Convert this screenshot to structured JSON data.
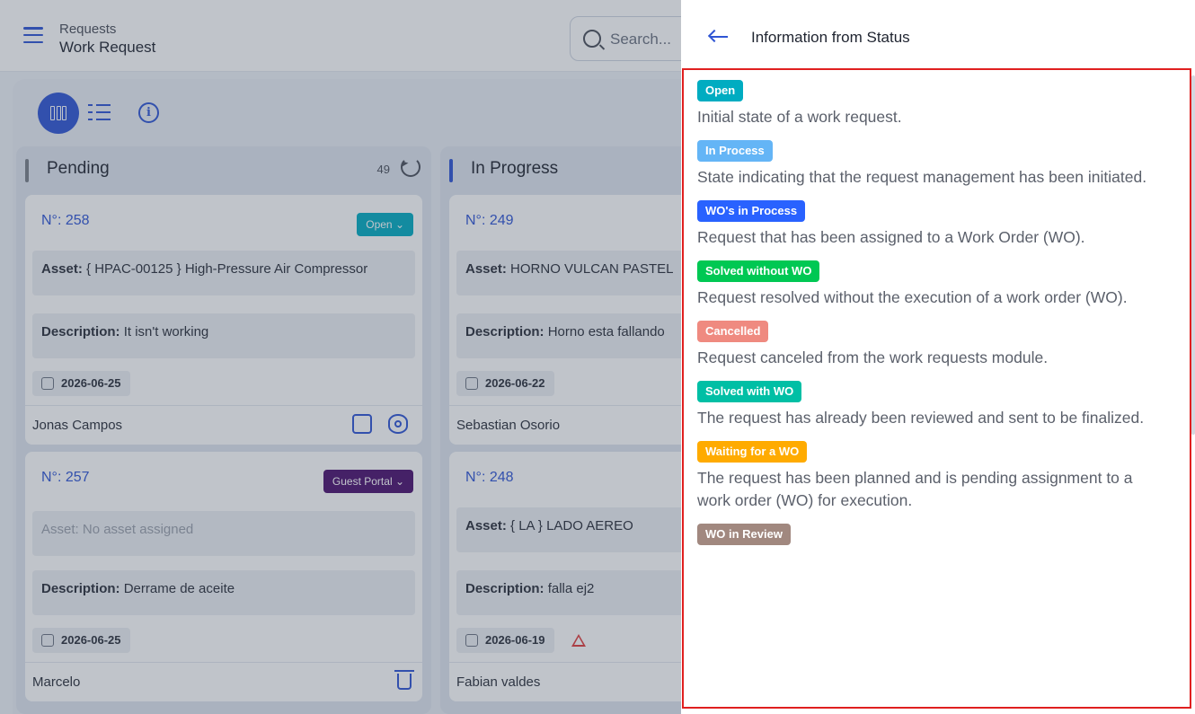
{
  "header": {
    "breadcrumb_parent": "Requests",
    "page_title": "Work Request",
    "search_placeholder": "Search..."
  },
  "board": {
    "columns": [
      {
        "title": "Pending",
        "count": "49",
        "marker_color": "#7a7f88",
        "cards": [
          {
            "number": "N°: 258",
            "status": "Open ⌄",
            "status_color": "#00acc1",
            "asset_label": "Asset:",
            "asset_value": "{ HPAC-00125 } High-Pressure Air Compressor",
            "description_label": "Description:",
            "description_value": "It isn't working",
            "date": "2026-06-25",
            "user": "Jonas Campos"
          },
          {
            "number": "N°: 257",
            "status": "Guest Portal ⌄",
            "status_color": "#4b0f6e",
            "asset_label": "Asset:",
            "asset_value": "No asset assigned",
            "description_label": "Description:",
            "description_value": "Derrame de aceite",
            "date": "2026-06-25",
            "user": "Marcelo"
          }
        ]
      },
      {
        "title": "In Progress",
        "marker_color": "#2f55d4",
        "cards": [
          {
            "number": "N°: 249",
            "asset_label": "Asset:",
            "asset_value": " HORNO VULCAN PASTEL",
            "description_label": "Description:",
            "description_value": "Horno esta fallando",
            "date": "2026-06-22",
            "user": "Sebastian Osorio"
          },
          {
            "number": "N°: 248",
            "asset_label": "Asset:",
            "asset_value": "{ LA } LADO AEREO",
            "description_label": "Description:",
            "description_value": "falla ej2",
            "date": "2026-06-19",
            "user": "Fabian valdes"
          }
        ]
      }
    ]
  },
  "drawer": {
    "title": "Information from Status",
    "statuses": [
      {
        "label": "Open",
        "color": "#00acc1",
        "description": "Initial state of a work request."
      },
      {
        "label": "In Process",
        "color": "#64b5f6",
        "description": "State indicating that the request management has been initiated."
      },
      {
        "label": "WO's in Process",
        "color": "#2962ff",
        "description": "Request that has been assigned to a Work Order (WO)."
      },
      {
        "label": "Solved without WO",
        "color": "#00c853",
        "description": "Request resolved without the execution of a work order (WO)."
      },
      {
        "label": "Cancelled",
        "color": "#ef8a80",
        "description": "Request canceled from the work requests module."
      },
      {
        "label": "Solved with WO",
        "color": "#00bfa5",
        "description": "The request has already been reviewed and sent to be finalized."
      },
      {
        "label": "Waiting for a WO",
        "color": "#ffab00",
        "description": "The request has been planned and is pending assignment to a work order (WO) for execution."
      },
      {
        "label": "WO in Review",
        "color": "#a1887f",
        "description": ""
      }
    ]
  }
}
